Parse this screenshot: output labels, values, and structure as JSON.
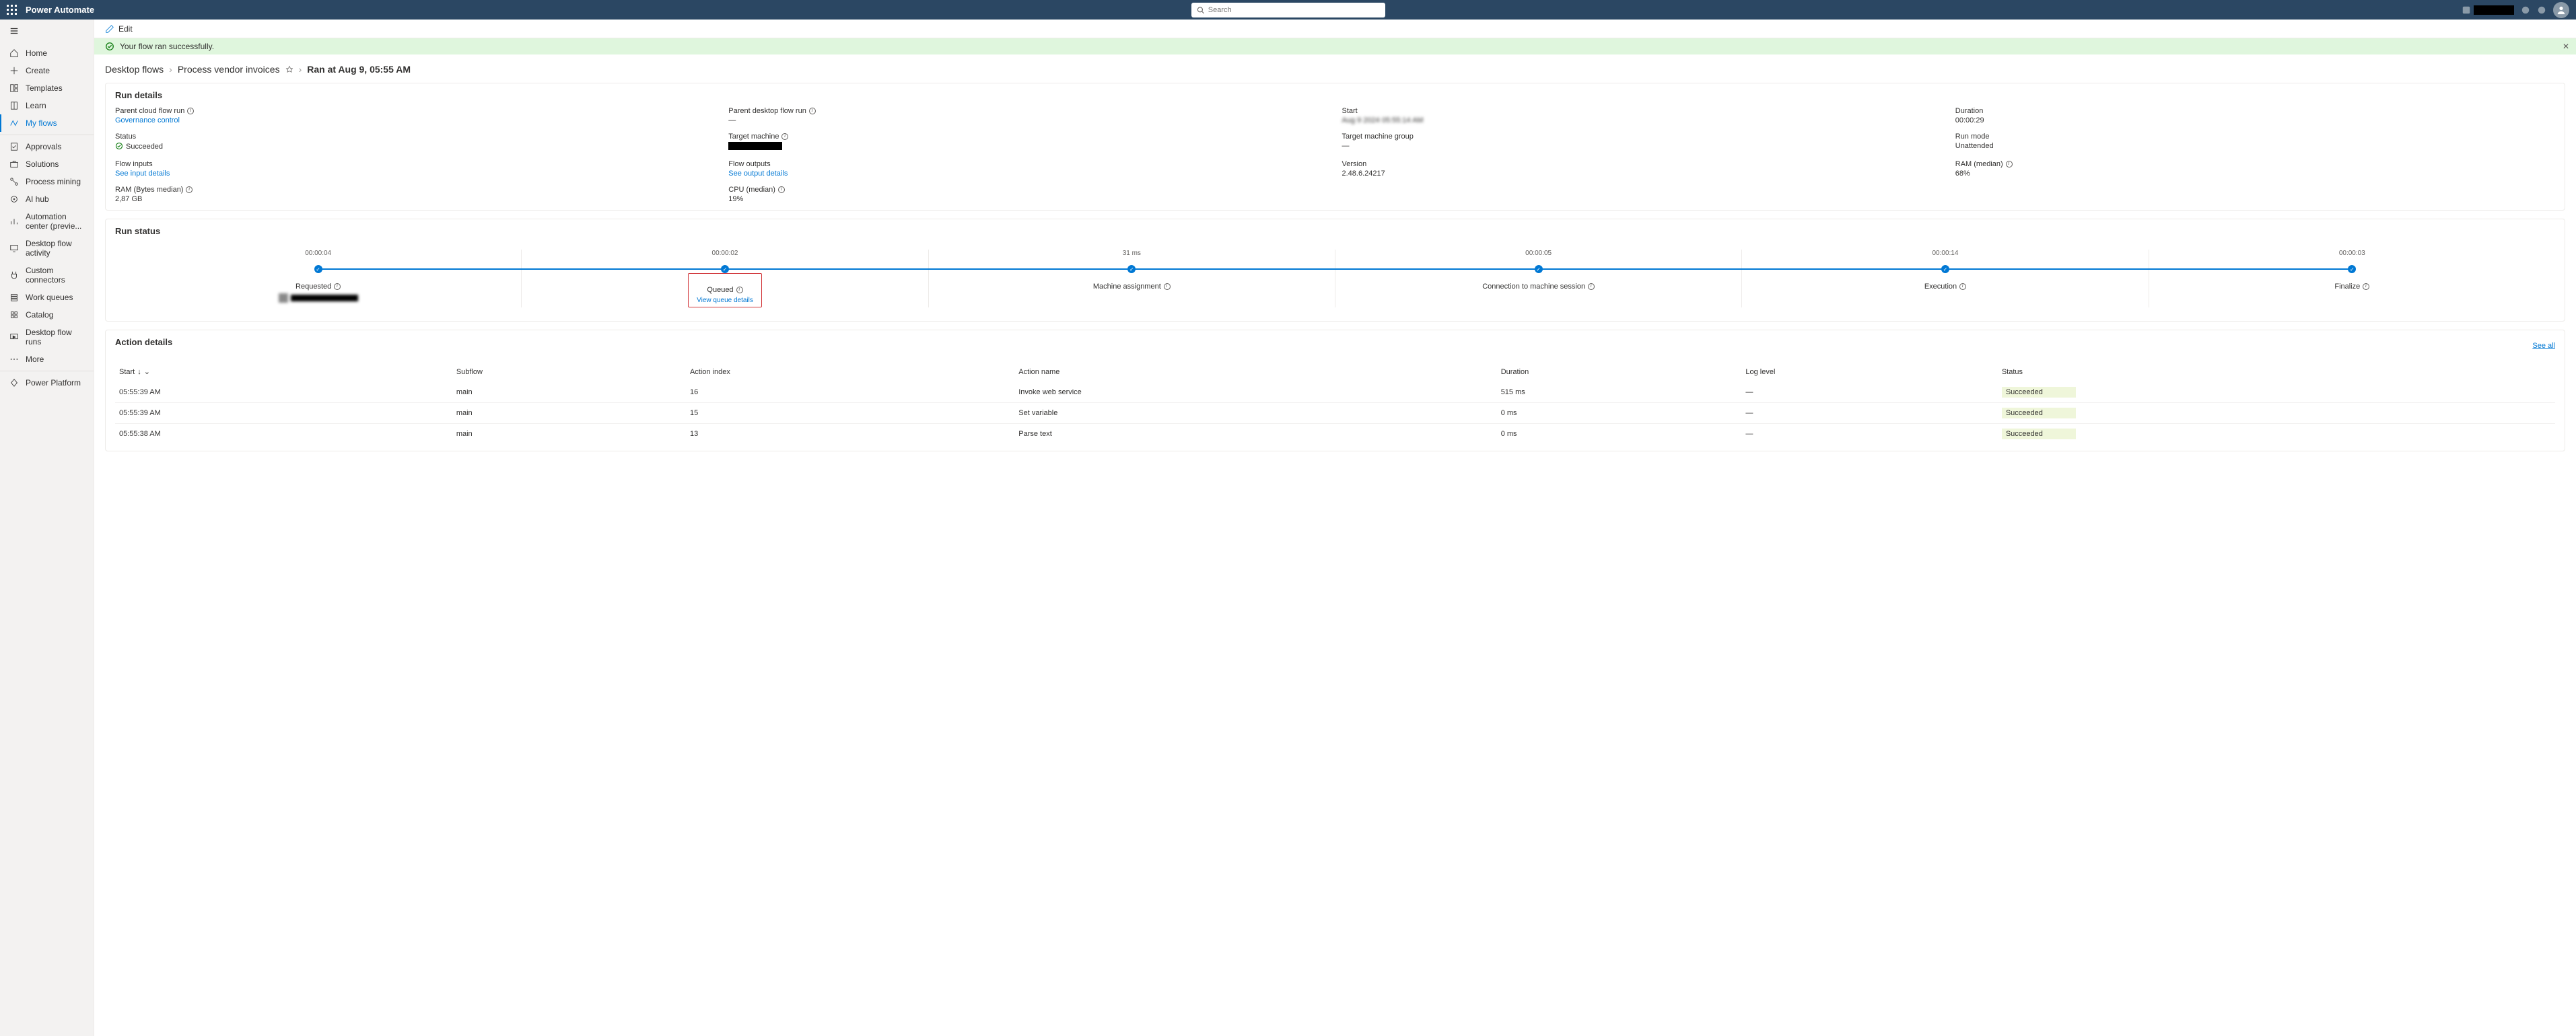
{
  "app": {
    "name": "Power Automate"
  },
  "search": {
    "placeholder": "Search"
  },
  "sidebar": {
    "items": [
      {
        "label": "Home"
      },
      {
        "label": "Create"
      },
      {
        "label": "Templates"
      },
      {
        "label": "Learn"
      },
      {
        "label": "My flows"
      },
      {
        "label": "Approvals"
      },
      {
        "label": "Solutions"
      },
      {
        "label": "Process mining"
      },
      {
        "label": "AI hub"
      },
      {
        "label": "Automation center (previe..."
      },
      {
        "label": "Desktop flow activity"
      },
      {
        "label": "Custom connectors"
      },
      {
        "label": "Work queues"
      },
      {
        "label": "Catalog"
      },
      {
        "label": "Desktop flow runs"
      },
      {
        "label": "More"
      },
      {
        "label": "Power Platform"
      }
    ]
  },
  "edit": {
    "label": "Edit"
  },
  "banner": {
    "text": "Your flow ran successfully."
  },
  "breadcrumb": {
    "root": "Desktop flows",
    "flow": "Process vendor invoices",
    "current": "Ran at Aug 9, 05:55 AM"
  },
  "runDetails": {
    "title": "Run details",
    "items": {
      "parentCloud": {
        "label": "Parent cloud flow run",
        "value": "Governance control",
        "link": true
      },
      "parentDesktop": {
        "label": "Parent desktop flow run",
        "value": "—"
      },
      "start": {
        "label": "Start",
        "value": ""
      },
      "duration": {
        "label": "Duration",
        "value": "00:00:29"
      },
      "status": {
        "label": "Status",
        "value": "Succeeded"
      },
      "targetMachine": {
        "label": "Target machine",
        "value": ""
      },
      "targetGroup": {
        "label": "Target machine group",
        "value": "—"
      },
      "runMode": {
        "label": "Run mode",
        "value": "Unattended"
      },
      "flowInputs": {
        "label": "Flow inputs",
        "value": "See input details",
        "link": true
      },
      "flowOutputs": {
        "label": "Flow outputs",
        "value": "See output details",
        "link": true
      },
      "version": {
        "label": "Version",
        "value": "2.48.6.24217"
      },
      "ramMedian": {
        "label": "RAM (median)",
        "value": "68%"
      },
      "ramBytes": {
        "label": "RAM (Bytes median)",
        "value": "2,87 GB"
      },
      "cpuMedian": {
        "label": "CPU (median)",
        "value": "19%"
      }
    }
  },
  "runStatus": {
    "title": "Run status",
    "steps": [
      {
        "duration": "00:00:04",
        "name": "Requested"
      },
      {
        "duration": "00:00:02",
        "name": "Queued",
        "extraLink": "View queue details"
      },
      {
        "duration": "31 ms",
        "name": "Machine assignment"
      },
      {
        "duration": "00:00:05",
        "name": "Connection to machine session"
      },
      {
        "duration": "00:00:14",
        "name": "Execution"
      },
      {
        "duration": "00:00:03",
        "name": "Finalize"
      }
    ]
  },
  "actionDetails": {
    "title": "Action details",
    "seeAll": "See all",
    "columns": {
      "start": "Start",
      "subflow": "Subflow",
      "index": "Action index",
      "name": "Action name",
      "duration": "Duration",
      "loglevel": "Log level",
      "status": "Status"
    },
    "rows": [
      {
        "start": "05:55:39 AM",
        "subflow": "main",
        "index": "16",
        "name": "Invoke web service",
        "duration": "515 ms",
        "loglevel": "—",
        "status": "Succeeded"
      },
      {
        "start": "05:55:39 AM",
        "subflow": "main",
        "index": "15",
        "name": "Set variable",
        "duration": "0 ms",
        "loglevel": "—",
        "status": "Succeeded"
      },
      {
        "start": "05:55:38 AM",
        "subflow": "main",
        "index": "13",
        "name": "Parse text",
        "duration": "0 ms",
        "loglevel": "—",
        "status": "Succeeded"
      }
    ]
  }
}
